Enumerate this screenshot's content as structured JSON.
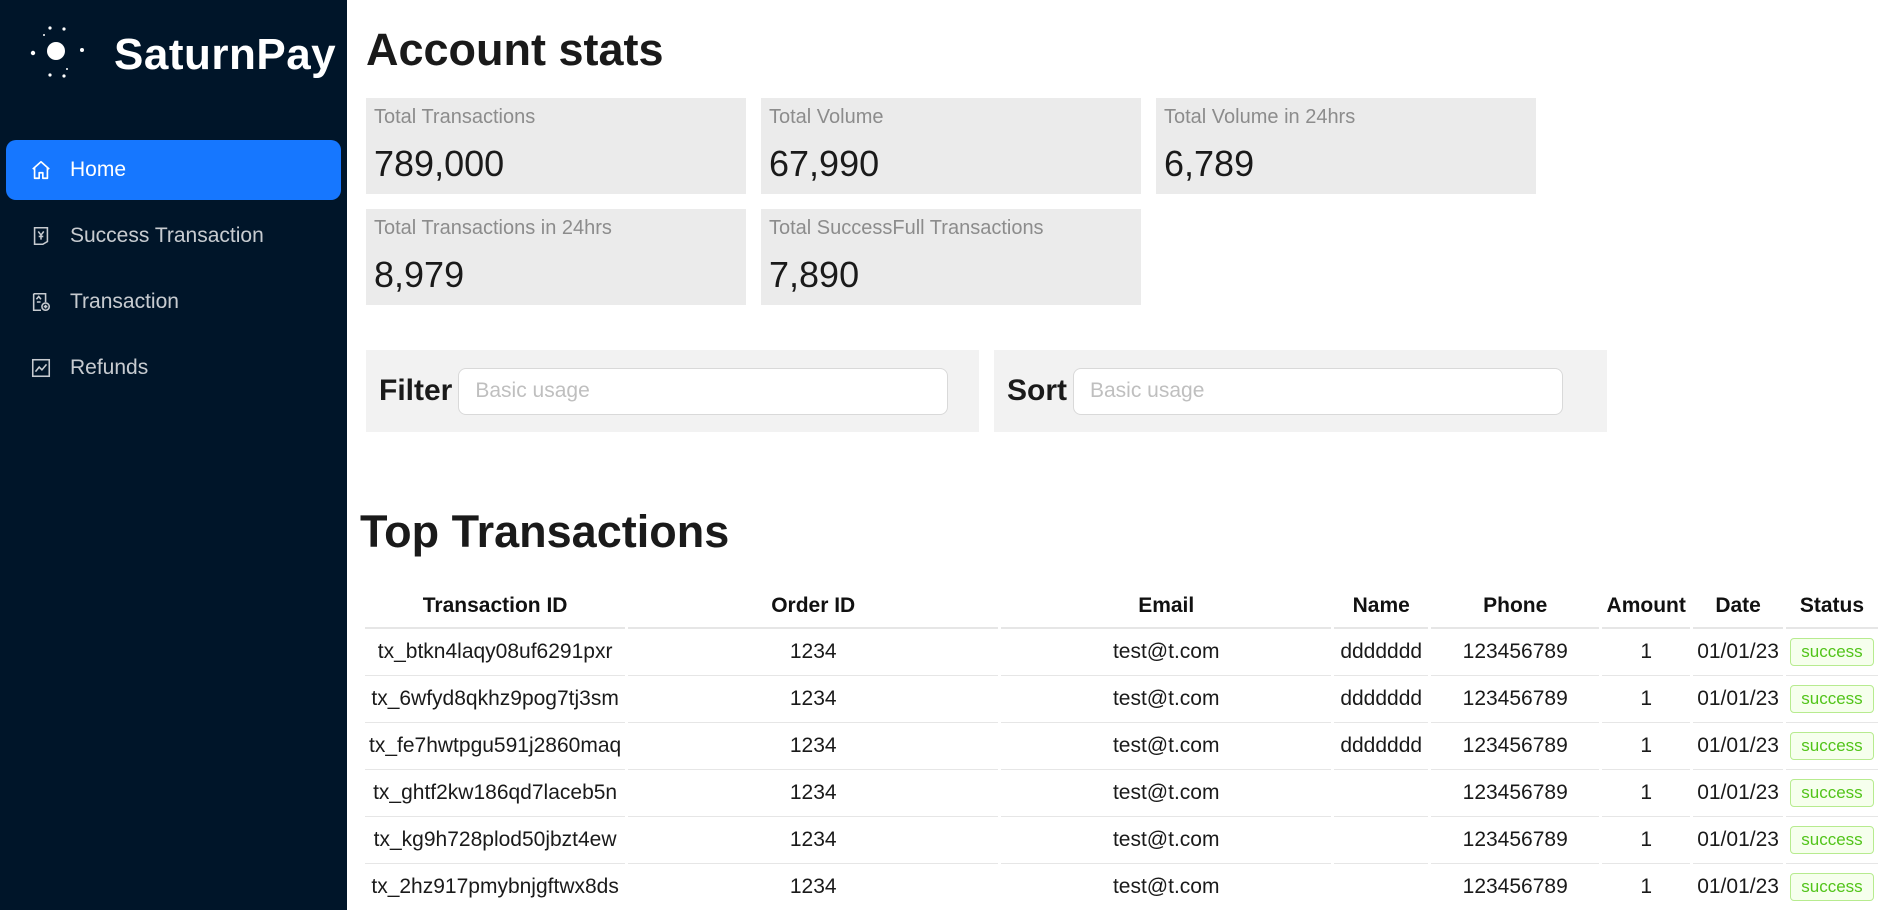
{
  "brand": {
    "name": "SaturnPay"
  },
  "sidebar": {
    "items": [
      {
        "label": "Home",
        "icon": "home-icon",
        "active": true
      },
      {
        "label": "Success Transaction",
        "icon": "yen-receipt-icon",
        "active": false
      },
      {
        "label": "Transaction",
        "icon": "account-book-icon",
        "active": false
      },
      {
        "label": "Refunds",
        "icon": "line-chart-icon",
        "active": false
      }
    ]
  },
  "page": {
    "title": "Account stats"
  },
  "stats": [
    {
      "label": "Total Transactions",
      "value": "789,000"
    },
    {
      "label": "Total Volume",
      "value": "67,990"
    },
    {
      "label": "Total Volume in 24hrs",
      "value": "6,789"
    },
    {
      "label": "Total Transactions in 24hrs",
      "value": "8,979"
    },
    {
      "label": "Total SuccessFull Transactions",
      "value": "7,890"
    }
  ],
  "filter": {
    "label": "Filter",
    "placeholder": "Basic usage",
    "value": ""
  },
  "sort": {
    "label": "Sort",
    "placeholder": "Basic usage",
    "value": ""
  },
  "table": {
    "title": "Top Transactions",
    "columns": [
      "Transaction ID",
      "Order ID",
      "Email",
      "Name",
      "Phone",
      "Amount",
      "Date",
      "Status"
    ],
    "rows": [
      {
        "tx": "tx_btkn4laqy08uf6291pxr",
        "order": "1234",
        "email": "test@t.com",
        "name": "ddddddd",
        "phone": "123456789",
        "amount": "1",
        "date": "01/01/23",
        "status": "success"
      },
      {
        "tx": "tx_6wfyd8qkhz9pog7tj3sm",
        "order": "1234",
        "email": "test@t.com",
        "name": "ddddddd",
        "phone": "123456789",
        "amount": "1",
        "date": "01/01/23",
        "status": "success"
      },
      {
        "tx": "tx_fe7hwtpgu591j2860maq",
        "order": "1234",
        "email": "test@t.com",
        "name": "ddddddd",
        "phone": "123456789",
        "amount": "1",
        "date": "01/01/23",
        "status": "success"
      },
      {
        "tx": "tx_ghtf2kw186qd7laceb5n",
        "order": "1234",
        "email": "test@t.com",
        "name": "",
        "phone": "123456789",
        "amount": "1",
        "date": "01/01/23",
        "status": "success"
      },
      {
        "tx": "tx_kg9h728plod50jbzt4ew",
        "order": "1234",
        "email": "test@t.com",
        "name": "",
        "phone": "123456789",
        "amount": "1",
        "date": "01/01/23",
        "status": "success"
      },
      {
        "tx": "tx_2hz917pmybnjgftwx8ds",
        "order": "1234",
        "email": "test@t.com",
        "name": "",
        "phone": "123456789",
        "amount": "1",
        "date": "01/01/23",
        "status": "success"
      }
    ]
  },
  "colors": {
    "sidebar_bg": "#001529",
    "accent": "#1677ff",
    "card_bg": "#ebebeb",
    "success": "#52c41a"
  }
}
